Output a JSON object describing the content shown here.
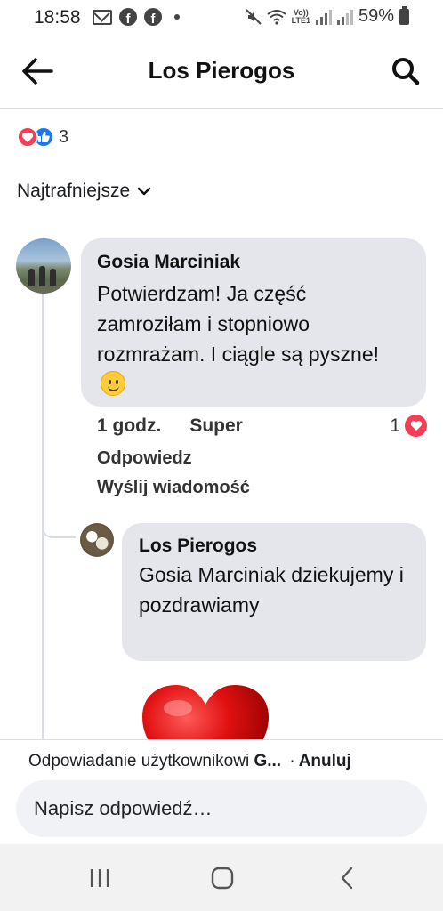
{
  "status_bar": {
    "time": "18:58",
    "battery": "59%",
    "volte": "Vo))\nLTE1",
    "icons_left": [
      "mail-icon",
      "facebook-icon",
      "facebook-icon",
      "dot-icon"
    ],
    "icons_right": [
      "mute-icon",
      "wifi-icon",
      "volte-icon",
      "signal-icon",
      "signal-icon",
      "battery-icon"
    ]
  },
  "header": {
    "title": "Los Pierogos",
    "back_icon": "arrow-left-icon",
    "search_icon": "search-icon"
  },
  "reactions": {
    "count": "3",
    "types": [
      "love",
      "like"
    ]
  },
  "sort": {
    "label": "Najtrafniejsze",
    "icon": "chevron-down-icon"
  },
  "comment": {
    "author": "Gosia Marciniak",
    "text": "Potwierdzam! Ja część zamroziłam i stopniowo rozmrażam. I ciągle są pyszne!",
    "emoji": "smiley-emoji",
    "time": "1 godz.",
    "super_label": "Super",
    "reply_label": "Odpowiedz",
    "message_label": "Wyślij wiadomość",
    "love_count": "1"
  },
  "reply": {
    "author": "Los Pierogos",
    "text": "Gosia Marciniak dziekujemy i pozdrawiamy",
    "sticker": "red-heart-sticker"
  },
  "reply_bar": {
    "prefix": "Odpowiadanie użytkownikowi",
    "target": "G...",
    "separator": "·",
    "cancel_label": "Anuluj",
    "placeholder": "Napisz odpowiedź…"
  },
  "nav": {
    "recent_icon": "recent-apps-icon",
    "home_icon": "home-icon",
    "back_icon": "back-chevron-icon"
  },
  "colors": {
    "love": "#f33e58",
    "like": "#1877f2",
    "bubble": "#e4e6eb",
    "input": "#f0f2f5"
  }
}
